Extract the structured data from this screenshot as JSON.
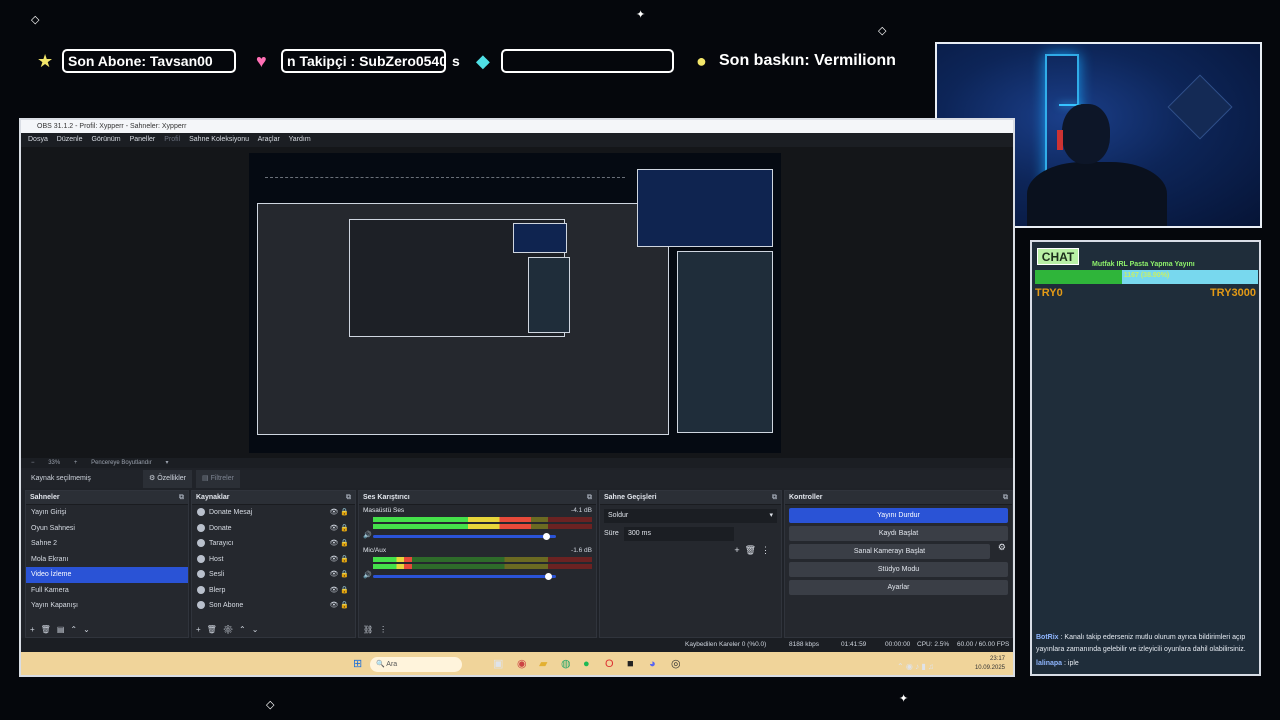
{
  "overlay": {
    "subscriber_label": "Son Abone: Tavsan00",
    "follower_label": "n Takipçi : SubZero0540",
    "follower_trail": "s",
    "donation_label": "",
    "raid_label": "Son baskın: Vermilionn",
    "colors": {
      "star": "#f3e66a",
      "heart": "#ff6fb5",
      "gem": "#4fe0e6",
      "circle": "#f3e66a"
    }
  },
  "chat": {
    "badge": "CHAT",
    "goal_title": "Mutfak IRL Pasta Yapma Yayını",
    "goal_progress_text": "1167 (38.90%)",
    "goal_fraction": 0.389,
    "goal_min": "TRY0",
    "goal_max": "TRY3000",
    "messages": [
      {
        "user": "BotRix",
        "text": "Kanalı takip ederseniz mutlu olurum ayrıca bildirimleri açıp yayınlara zamanında gelebilir ve izleyicili oyunlara dahil olabilirsiniz."
      },
      {
        "user": "lalinapa",
        "text": "iple"
      }
    ]
  },
  "obs": {
    "title": "OBS 31.1.2 - Profil: Xypperr - Sahneler: Xypperr",
    "menu": [
      "Dosya",
      "Düzenle",
      "Görünüm",
      "Paneller",
      "Profil",
      "Sahne Koleksiyonu",
      "Araçlar",
      "Yardım"
    ],
    "zoom": "33%",
    "fit_label": "Pencereye Boyutlandır",
    "no_source": "Kaynak seçilmemiş",
    "properties_label": "Özellikler",
    "filters_label": "Filtreler",
    "scenes": {
      "title": "Sahneler",
      "items": [
        "Yayın Girişi",
        "Oyun Sahnesi",
        "Sahne 2",
        "Mola Ekranı",
        "Video İzleme",
        "Full Kamera",
        "Yayın Kapanışı"
      ],
      "selected_index": 4
    },
    "sources": {
      "title": "Kaynaklar",
      "items": [
        "Donate Mesaj",
        "Donate",
        "Tarayıcı",
        "Host",
        "Sesli",
        "Blerp",
        "Son Abone"
      ]
    },
    "mixer": {
      "title": "Ses Karıştırıcı",
      "channels": [
        {
          "name": "Masaüstü Ses",
          "db": "-4.1 dB",
          "level": 0.72,
          "volume": 0.95
        },
        {
          "name": "Mic/Aux",
          "db": "-1.6 dB",
          "level": 0.18,
          "volume": 0.96
        }
      ],
      "scale": [
        "-60",
        "-55",
        "-50",
        "-45",
        "-40",
        "-35",
        "-30",
        "-25",
        "-20",
        "-15",
        "-10",
        "-5",
        "0"
      ]
    },
    "transitions": {
      "title": "Sahne Geçişleri",
      "type": "Soldur",
      "duration_label": "Süre",
      "duration_value": "300 ms"
    },
    "controls": {
      "title": "Kontroller",
      "buttons": [
        "Yayını Durdur",
        "Kaydı Başlat",
        "Sanal Kamerayı Başlat",
        "Stüdyo Modu",
        "Ayarlar"
      ]
    },
    "status": {
      "dropped": "Kaybedilen Kareler 0 (%0.0)",
      "bitrate": "8188 kbps",
      "live_time": "01:41:59",
      "rec_time": "00:00:00",
      "cpu": "CPU: 2.5%",
      "fps": "60.00 / 60.00 FPS"
    }
  },
  "taskbar": {
    "search_placeholder": "Ara",
    "time": "23:17",
    "date": "10.09.2025"
  }
}
